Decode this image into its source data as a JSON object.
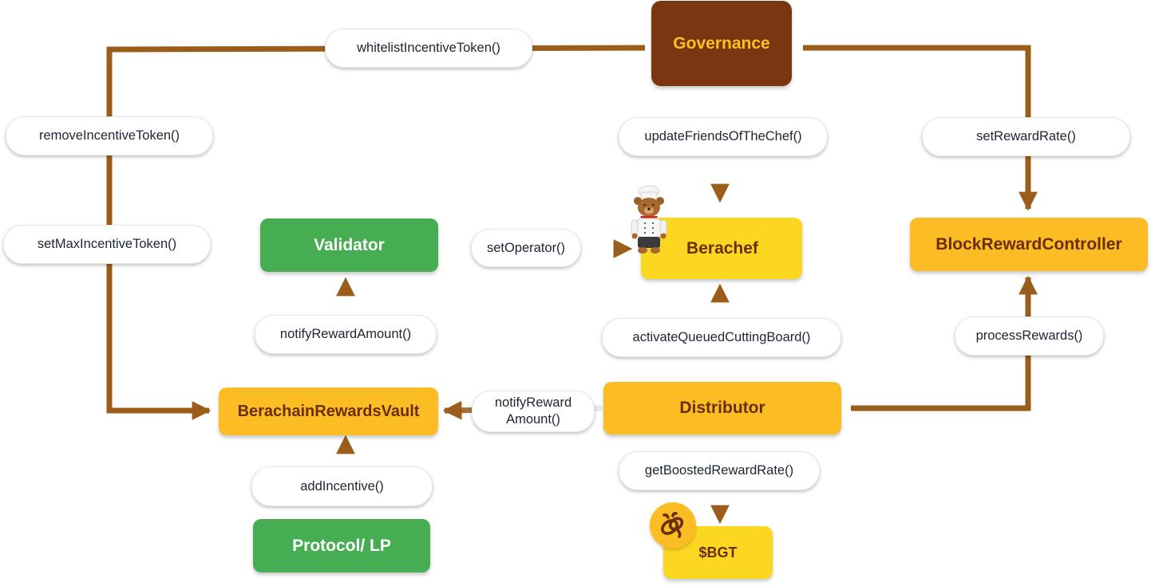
{
  "diagram": {
    "colors": {
      "wire": "#9a5e1a",
      "governance_bg": "#7a3610",
      "governance_text": "#fcbf24",
      "green": "#47ad53",
      "amber": "#fbbd23",
      "yellow": "#fcd722",
      "dark_text": "#6b2e0c"
    },
    "nodes": {
      "governance": "Governance",
      "berachef": "Berachef",
      "validator": "Validator",
      "block_reward_controller": "BlockRewardController",
      "berachain_rewards_vault": "BerachainRewardsVault",
      "distributor": "Distributor",
      "protocol_lp": "Protocol/ LP",
      "bgt": "$BGT"
    },
    "functions": {
      "whitelist_incentive_token": "whitelistIncentiveToken()",
      "remove_incentive_token": "removeIncentiveToken()",
      "set_max_incentive_token": "setMaxIncentiveToken()",
      "update_friends_of_the_chef": "updateFriendsOfTheChef()",
      "set_reward_rate": "setRewardRate()",
      "set_operator": "setOperator()",
      "notify_reward_amount_validator": "notifyRewardAmount()",
      "activate_queued_cutting_board": "activateQueuedCuttingBoard()",
      "process_rewards": "processRewards()",
      "notify_reward_amount_vault_line1": "notifyReward",
      "notify_reward_amount_vault_line2": "Amount()",
      "get_boosted_reward_rate": "getBoostedRewardRate()",
      "add_incentive": "addIncentive()"
    },
    "icons": {
      "berachef_mascot": "chef-bear-icon",
      "bgt_token": "bee-icon"
    }
  }
}
